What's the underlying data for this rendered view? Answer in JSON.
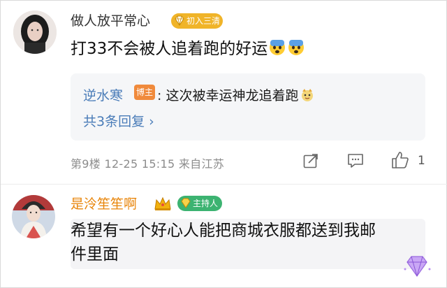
{
  "comment1": {
    "username": "做人放平常心",
    "badge": "初入三清",
    "text": "打33不会被人追着跑的好运",
    "reply": {
      "author": "逆水寒",
      "author_tag": "博主",
      "text": "这次被幸运神龙追着跑",
      "more_label": "共3条回复 ›"
    },
    "meta": "第9楼  12-25 15:15  来自江苏",
    "like_count": "1"
  },
  "comment2": {
    "username": "是泠笙笙啊",
    "badge": "主持人",
    "text_line1": "希望有一个好心人能把商城衣服都送到我邮",
    "text_line2": "件里面"
  },
  "colors": {
    "username_gold": "#e8850a",
    "link_blue": "#4a7cb8",
    "badge_gold": "#f0b429",
    "badge_green": "#3cb371"
  },
  "icons": [
    "share-icon",
    "comment-icon",
    "like-icon",
    "crown-icon",
    "gem-icon",
    "fearful-emoji",
    "dragon-emoji"
  ]
}
